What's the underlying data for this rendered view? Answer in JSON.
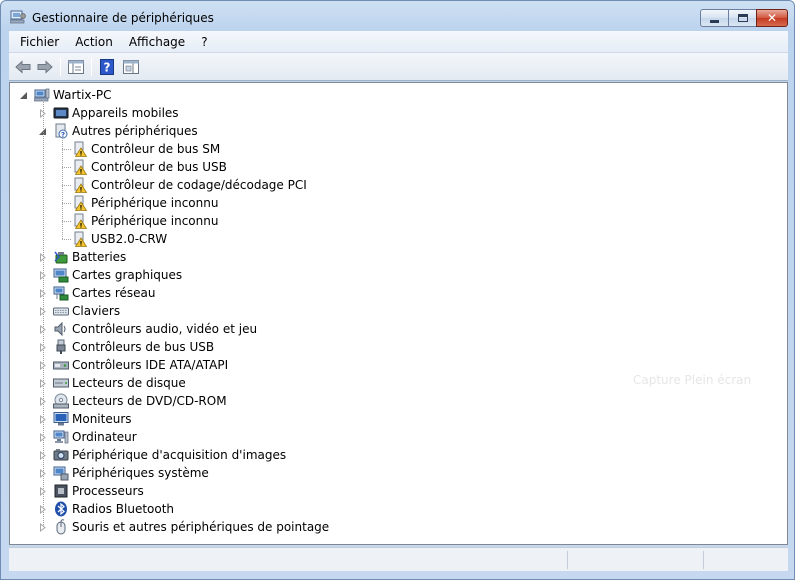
{
  "window": {
    "title": "Gestionnaire de périphériques"
  },
  "menu": [
    "Fichier",
    "Action",
    "Affichage",
    "?"
  ],
  "toolbar": {
    "buttons": [
      "back-arrow-icon",
      "forward-arrow-icon",
      "console-tree-icon",
      "help-icon",
      "properties-icon"
    ]
  },
  "tree": {
    "root": "Wartix-PC",
    "categories": [
      {
        "label": "Appareils mobiles",
        "icon": "mobile-device-icon",
        "expanded": false
      },
      {
        "label": "Autres périphériques",
        "icon": "unknown-device-icon",
        "expanded": true,
        "children": [
          "Contrôleur de bus SM",
          "Contrôleur de bus USB",
          "Contrôleur de codage/décodage PCI",
          "Périphérique inconnu",
          "Périphérique inconnu",
          "USB2.0-CRW"
        ]
      },
      {
        "label": "Batteries",
        "icon": "battery-icon",
        "expanded": false
      },
      {
        "label": "Cartes graphiques",
        "icon": "display-adapter-icon",
        "expanded": false
      },
      {
        "label": "Cartes réseau",
        "icon": "network-adapter-icon",
        "expanded": false
      },
      {
        "label": "Claviers",
        "icon": "keyboard-icon",
        "expanded": false
      },
      {
        "label": "Contrôleurs audio, vidéo et jeu",
        "icon": "speaker-icon",
        "expanded": false
      },
      {
        "label": "Contrôleurs de bus USB",
        "icon": "usb-icon",
        "expanded": false
      },
      {
        "label": "Contrôleurs IDE ATA/ATAPI",
        "icon": "ide-controller-icon",
        "expanded": false
      },
      {
        "label": "Lecteurs de disque",
        "icon": "disk-drive-icon",
        "expanded": false
      },
      {
        "label": "Lecteurs de DVD/CD-ROM",
        "icon": "dvd-drive-icon",
        "expanded": false
      },
      {
        "label": "Moniteurs",
        "icon": "monitor-icon",
        "expanded": false
      },
      {
        "label": "Ordinateur",
        "icon": "computer-icon",
        "expanded": false
      },
      {
        "label": "Périphérique d'acquisition d'images",
        "icon": "camera-icon",
        "expanded": false
      },
      {
        "label": "Périphériques système",
        "icon": "system-device-icon",
        "expanded": false
      },
      {
        "label": "Processeurs",
        "icon": "processor-icon",
        "expanded": false
      },
      {
        "label": "Radios Bluetooth",
        "icon": "bluetooth-icon",
        "expanded": false
      },
      {
        "label": "Souris et autres périphériques de pointage",
        "icon": "mouse-icon",
        "expanded": false
      }
    ]
  },
  "overlay": {
    "watermark": "Capture Plein écran"
  },
  "colors": {
    "frame": "#bcd3ee",
    "close_button": "#c23a21",
    "warning": "#f4c430"
  }
}
